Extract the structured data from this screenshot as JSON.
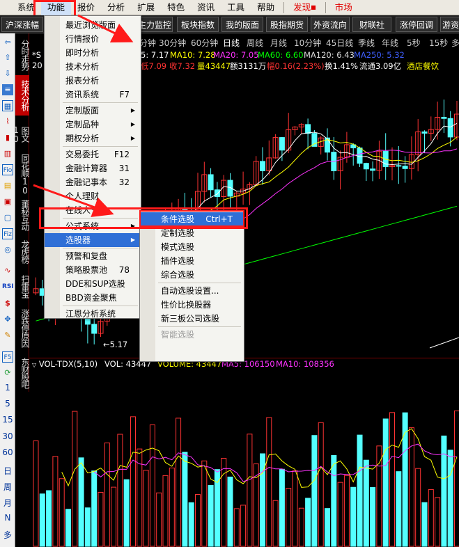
{
  "menubar": {
    "items": [
      "系统",
      "功能",
      "报价",
      "分析",
      "扩展",
      "特色",
      "资讯",
      "工具",
      "帮助"
    ],
    "extra": [
      "发现",
      "市场"
    ]
  },
  "toolbar": {
    "buttons": [
      "沪深涨幅",
      "主力监控",
      "板块指数",
      "我的版面",
      "股指期货",
      "外资流向",
      "财联社",
      "涨停回调",
      "游资"
    ]
  },
  "periods": [
    "分钟",
    "30分钟",
    "60分钟",
    "日线",
    "周线",
    "月线",
    "10分钟",
    "45日线",
    "季线",
    "年线",
    "5秒",
    "15秒",
    "多"
  ],
  "vertical_tabs": [
    "分时走势",
    "技术分析",
    "图文10",
    "同花顺10",
    "董秘互动",
    "龙虎榜",
    "扫雷宝",
    "涨跌停原因",
    "东财股吧"
  ],
  "left_icons": [
    "back-icon",
    "up-icon",
    "down-icon",
    "list-icon",
    "grid-icon",
    "line-chart-icon",
    "candle-icon",
    "k-chart-icon",
    "fio-icon",
    "note-icon",
    "fin-icon",
    "file-icon",
    "fiz-icon",
    "ring-icon",
    "wave-icon",
    "rsi-icon",
    "dollar-icon",
    "move-icon",
    "pencil-icon",
    "f5-icon",
    "refresh-icon"
  ],
  "left_texts": [
    "1",
    "5",
    "15",
    "30",
    "60",
    "日",
    "周",
    "月",
    "N",
    "多"
  ],
  "price_info": {
    "line1": {
      "prefix": "*S",
      "ma5": "5: 7.17",
      "ma10": "MA10: 7.28",
      "ma20": "MA20: 7.05",
      "ma60": "MA60: 6.60",
      "ma120": "MA120: 6.43",
      "ma250": "MA250: 5.32"
    },
    "line2": {
      "prefix": "20",
      "low": "低7.09",
      "close": "收7.32",
      "volume": "量43447",
      "amount": "额3131万",
      "change": "幅0.16(2.23%)",
      "turnover": "换1.41%",
      "float": "流通3.09亿",
      "sector": "酒店餐饮"
    }
  },
  "low_marker": "5.17",
  "volume_info": {
    "label": "VOL-TDX(5,10)",
    "vol": "VOL: 43447",
    "volume": "VOLUME: 43447",
    "ma5": "MA5: 106150",
    "ma10": "MA10: 108356"
  },
  "function_menu": {
    "items": [
      {
        "label": "最近浏览版面",
        "key": ""
      },
      {
        "label": "行情报价",
        "key": ""
      },
      {
        "label": "即时分析",
        "key": ""
      },
      {
        "label": "技术分析",
        "key": ""
      },
      {
        "label": "报表分析",
        "key": ""
      },
      {
        "label": "资讯系统",
        "key": "F7"
      },
      {
        "label": "定制版面",
        "key": ""
      },
      {
        "label": "定制品种",
        "key": ""
      },
      {
        "label": "期权分析",
        "key": ""
      },
      {
        "label": "交易委托",
        "key": "F12"
      },
      {
        "label": "金融计算器",
        "key": "31"
      },
      {
        "label": "金融记事本",
        "key": "32"
      },
      {
        "label": "个人理财",
        "key": ""
      },
      {
        "label": "在线人气",
        "key": ""
      },
      {
        "label": "公式系统",
        "key": ""
      },
      {
        "label": "选股器",
        "key": ""
      },
      {
        "label": "预警和复盘",
        "key": ""
      },
      {
        "label": "策略股票池",
        "key": "78"
      },
      {
        "label": "DDE和SUP选股",
        "key": ""
      },
      {
        "label": "BBD资金聚焦",
        "key": ""
      },
      {
        "label": "江恩分析系统",
        "key": ""
      }
    ]
  },
  "stock_picker_menu": {
    "items": [
      {
        "label": "条件选股",
        "key": "Ctrl+T"
      },
      {
        "label": "定制选股",
        "key": ""
      },
      {
        "label": "模式选股",
        "key": ""
      },
      {
        "label": "插件选股",
        "key": ""
      },
      {
        "label": "综合选股",
        "key": ""
      },
      {
        "label": "自动选股设置...",
        "key": ""
      },
      {
        "label": "性价比换股器",
        "key": ""
      },
      {
        "label": "新三板公司选股",
        "key": ""
      },
      {
        "label": "智能选股",
        "key": ""
      }
    ]
  },
  "colors": {
    "candle_up": "#ff3333",
    "candle_down": "#54ffff",
    "ma5": "#ffffff",
    "ma10": "#ffff00",
    "ma20": "#ff33ff",
    "ma60": "#00ff00",
    "highlight": "#ff1a1a",
    "menu_selection": "#2f6fd6"
  }
}
